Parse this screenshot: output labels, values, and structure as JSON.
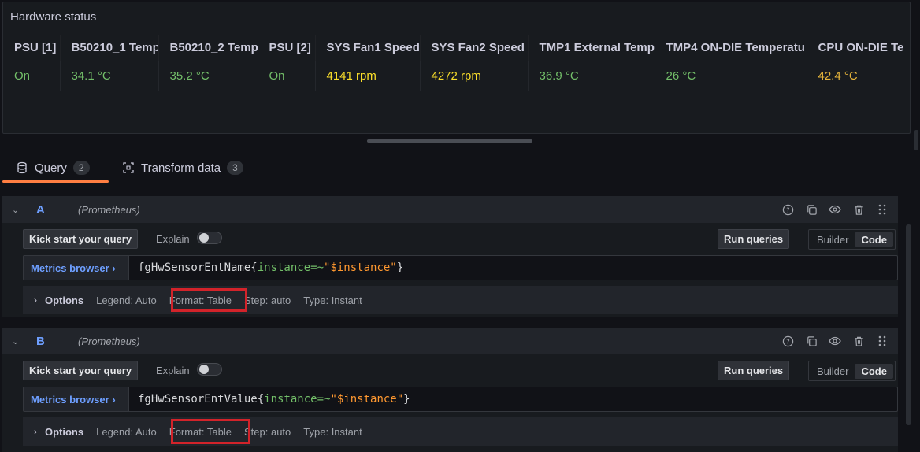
{
  "panel": {
    "title": "Hardware status",
    "columns": [
      "PSU [1]",
      "B50210_1 Temp",
      "B50210_2 Temp",
      "PSU [2]",
      "SYS Fan1 Speed",
      "SYS Fan2 Speed",
      "TMP1 External Temp",
      "TMP4 ON-DIE Temperatu",
      "CPU ON-DIE Te"
    ],
    "row": [
      "On",
      "34.1 °C",
      "35.2 °C",
      "On",
      "4141 rpm",
      "4272 rpm",
      "36.9 °C",
      "26 °C",
      "42.4 °C"
    ],
    "colors": {
      "green": "#73bf69",
      "yellow": "#fade2a",
      "orange": "#e5b43b"
    }
  },
  "tabs": [
    {
      "label": "Query",
      "count": "2",
      "icon": "database-icon"
    },
    {
      "label": "Transform data",
      "count": "3",
      "icon": "transform-icon"
    }
  ],
  "queries": [
    {
      "letter": "A",
      "datasource": "(Prometheus)",
      "kick_label": "Kick start your query",
      "explain_label": "Explain",
      "run_label": "Run queries",
      "builder_label": "Builder",
      "code_label": "Code",
      "metrics_browser_label": "Metrics browser ›",
      "expr_metric": "fgHwSensorEntName{",
      "expr_key": "instance=~",
      "expr_value": "\"$instance\"",
      "expr_close": "}",
      "options_label": "Options",
      "legend": "Legend: Auto",
      "format": "Format: Table",
      "step": "Step: auto",
      "type": "Type: Instant"
    },
    {
      "letter": "B",
      "datasource": "(Prometheus)",
      "kick_label": "Kick start your query",
      "explain_label": "Explain",
      "run_label": "Run queries",
      "builder_label": "Builder",
      "code_label": "Code",
      "metrics_browser_label": "Metrics browser ›",
      "expr_metric": "fgHwSensorEntValue{",
      "expr_key": "instance=~",
      "expr_value": "\"$instance\"",
      "expr_close": "}",
      "options_label": "Options",
      "legend": "Legend: Auto",
      "format": "Format: Table",
      "step": "Step: auto",
      "type": "Type: Instant"
    }
  ],
  "accent_colors": {
    "tab_underline": "#ff7e42",
    "highlight_box": "#d2232a",
    "link": "#6e9fff"
  }
}
